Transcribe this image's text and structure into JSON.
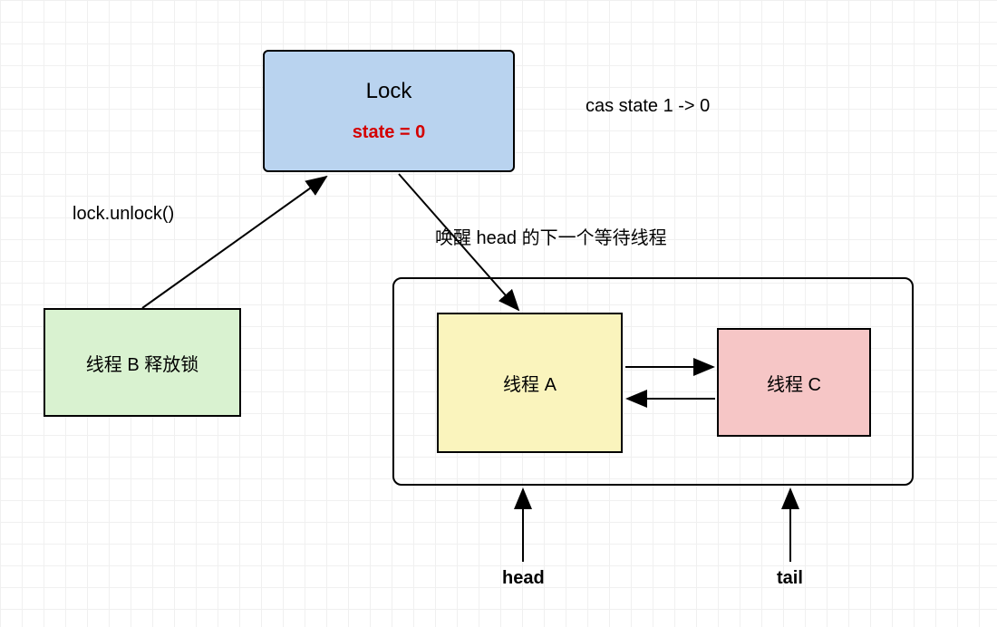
{
  "lock": {
    "title": "Lock",
    "state": "state = 0"
  },
  "threadB": {
    "label": "线程 B 释放锁"
  },
  "threadA": {
    "label": "线程 A"
  },
  "threadC": {
    "label": "线程 C"
  },
  "labels": {
    "cas": "cas state 1 -> 0",
    "unlock": "lock.unlock()",
    "wakeup": "唤醒 head 的下一个等待线程",
    "head": "head",
    "tail": "tail"
  }
}
